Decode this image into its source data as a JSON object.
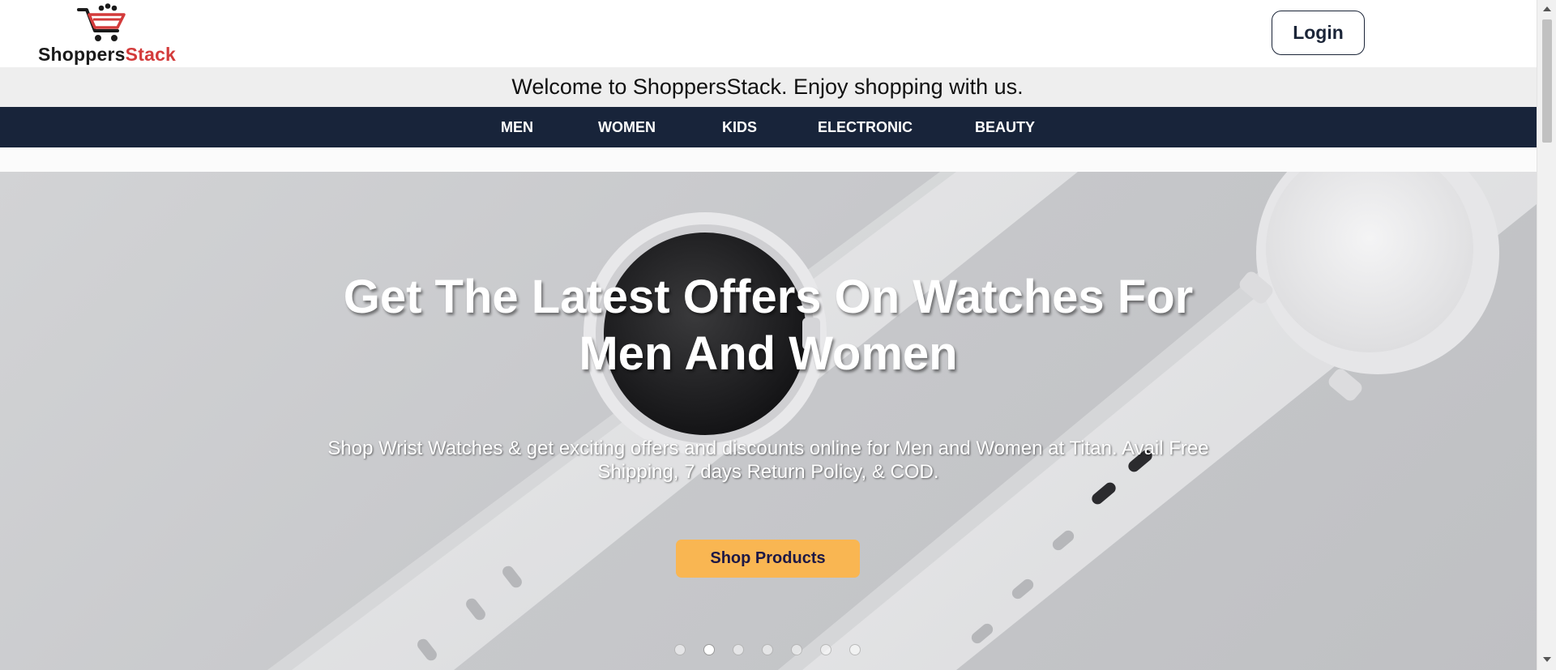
{
  "header": {
    "logo": {
      "text_part1": "Shoppers",
      "text_part2": "Stack",
      "icon": "shopping-cart-icon",
      "colors": {
        "dark": "#1a1a1a",
        "accent": "#d33b3b"
      }
    },
    "login_label": "Login"
  },
  "welcome_bar": {
    "text": "Welcome to ShoppersStack. Enjoy shopping with us."
  },
  "nav": {
    "items": [
      {
        "label": "MEN"
      },
      {
        "label": "WOMEN"
      },
      {
        "label": "KIDS"
      },
      {
        "label": "ELECTRONIC"
      },
      {
        "label": "BEAUTY"
      }
    ],
    "background": "#18243a"
  },
  "hero": {
    "title": "Get The Latest Offers On Watches For Men And Women",
    "subtitle": "Shop Wrist Watches & get exciting offers and discounts online for Men and Women at Titan. Avail Free Shipping, 7 days Return Policy, & COD.",
    "cta_label": "Shop Products",
    "cta_color": "#f9b652",
    "carousel": {
      "slide_count": 7,
      "active_index": 1
    }
  }
}
